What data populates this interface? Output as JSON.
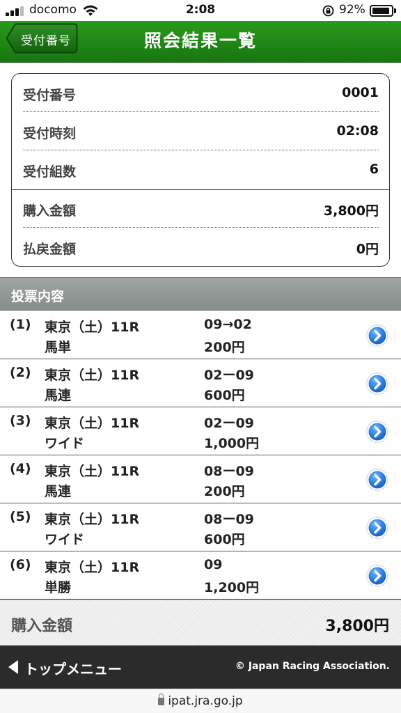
{
  "status_bar": {
    "carrier": "docomo",
    "time": "2:08",
    "battery_percent": "92%",
    "battery_level": 0.92
  },
  "header": {
    "back_label": "受付番号",
    "title": "照会結果一覧"
  },
  "summary": {
    "rows": [
      {
        "label": "受付番号",
        "value": "0001"
      },
      {
        "label": "受付時刻",
        "value": "02:08"
      },
      {
        "label": "受付組数",
        "value": "6"
      },
      {
        "label": "購入金額",
        "value": "3,800円"
      },
      {
        "label": "払戻金額",
        "value": "0円"
      }
    ]
  },
  "bets_section": {
    "title": "投票内容",
    "items": [
      {
        "num": "(1)",
        "race": "東京（土）11R",
        "type": "馬単",
        "combo": "09→02",
        "amount": "200円"
      },
      {
        "num": "(2)",
        "race": "東京（土）11R",
        "type": "馬連",
        "combo": "02ー09",
        "amount": "600円"
      },
      {
        "num": "(3)",
        "race": "東京（土）11R",
        "type": "ワイド",
        "combo": "02ー09",
        "amount": "1,000円"
      },
      {
        "num": "(4)",
        "race": "東京（土）11R",
        "type": "馬連",
        "combo": "08ー09",
        "amount": "200円"
      },
      {
        "num": "(5)",
        "race": "東京（土）11R",
        "type": "ワイド",
        "combo": "08ー09",
        "amount": "600円"
      },
      {
        "num": "(6)",
        "race": "東京（土）11R",
        "type": "単勝",
        "combo": "09",
        "amount": "1,200円"
      }
    ]
  },
  "total": {
    "label": "購入金額",
    "value": "3,800円"
  },
  "footer": {
    "top_menu_label": "トップメニュー",
    "copyright": "© Japan Racing Association."
  },
  "address_bar": {
    "url": "ipat.jra.go.jp"
  },
  "colors": {
    "header_green": "#1f8a17",
    "section_gray": "#9aa19f",
    "footer_dark": "#2b2b2b",
    "go_button_blue": "#1f6fd0"
  },
  "icons": {
    "back": "back-arrow-icon",
    "go": "chevron-right-circle-icon",
    "top_menu": "triangle-left-icon"
  }
}
